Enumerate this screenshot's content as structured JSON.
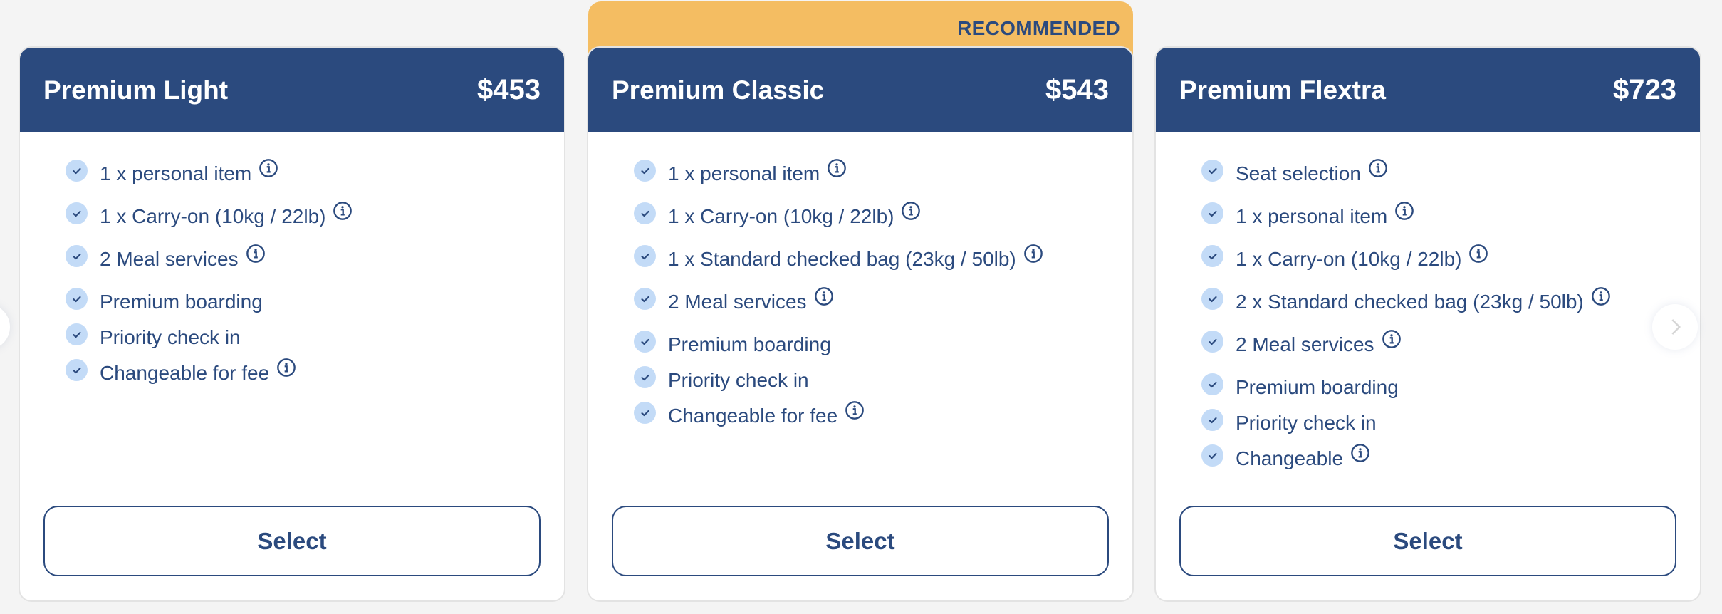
{
  "colors": {
    "brand": "#2b4a7e",
    "recommended_banner": "#f4bd62",
    "check_circle": "#c3dbf7",
    "background": "#f4f4f4"
  },
  "carousel": {
    "prev_icon": "chevron-left-icon",
    "next_icon": "chevron-right-icon"
  },
  "plans": [
    {
      "name": "Premium Light",
      "price": "$453",
      "recommended": false,
      "select_label": "Select",
      "features": [
        {
          "text": "1 x personal item",
          "info": true
        },
        {
          "text": "1 x Carry-on (10kg / 22lb)",
          "info": true
        },
        {
          "text": "2 Meal services",
          "info": true
        },
        {
          "text": "Premium boarding",
          "info": false
        },
        {
          "text": "Priority check in",
          "info": false
        },
        {
          "text": "Changeable for fee",
          "info": true
        }
      ]
    },
    {
      "name": "Premium Classic",
      "price": "$543",
      "recommended": true,
      "recommended_label": "RECOMMENDED",
      "select_label": "Select",
      "features": [
        {
          "text": "1 x personal item",
          "info": true
        },
        {
          "text": "1 x Carry-on (10kg / 22lb)",
          "info": true
        },
        {
          "text": "1 x Standard checked bag (23kg / 50lb)",
          "info": true
        },
        {
          "text": "2 Meal services",
          "info": true
        },
        {
          "text": "Premium boarding",
          "info": false
        },
        {
          "text": "Priority check in",
          "info": false
        },
        {
          "text": "Changeable for fee",
          "info": true
        }
      ]
    },
    {
      "name": "Premium Flextra",
      "price": "$723",
      "recommended": false,
      "select_label": "Select",
      "features": [
        {
          "text": "Seat selection",
          "info": true
        },
        {
          "text": "1 x personal item",
          "info": true
        },
        {
          "text": "1 x Carry-on (10kg / 22lb)",
          "info": true
        },
        {
          "text": "2 x Standard checked bag (23kg / 50lb)",
          "info": true
        },
        {
          "text": "2 Meal services",
          "info": true
        },
        {
          "text": "Premium boarding",
          "info": false
        },
        {
          "text": "Priority check in",
          "info": false
        },
        {
          "text": "Changeable",
          "info": true
        }
      ]
    }
  ]
}
